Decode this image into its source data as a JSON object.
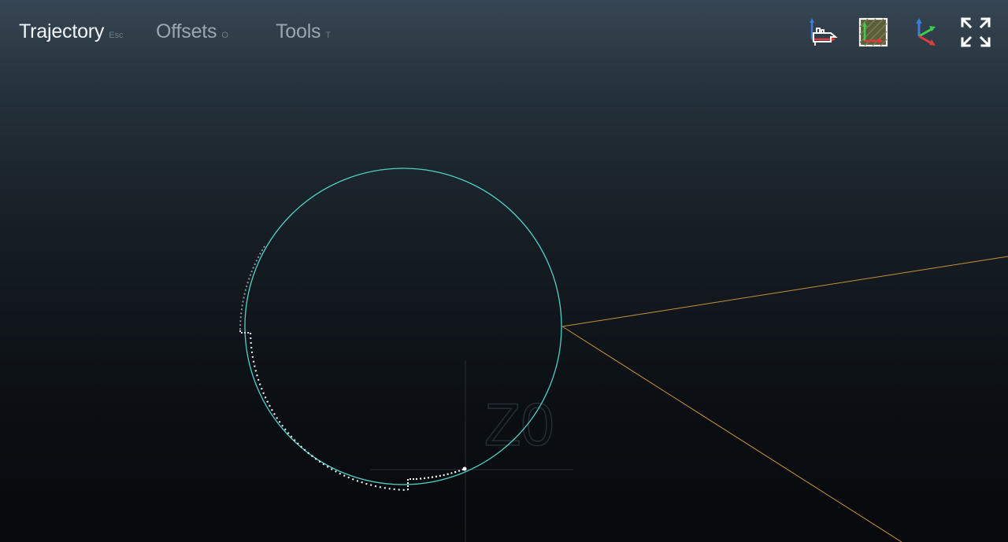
{
  "tabs": [
    {
      "label": "Trajectory",
      "key": "Esc",
      "active": true
    },
    {
      "label": "Offsets",
      "key": "O",
      "active": false
    },
    {
      "label": "Tools",
      "key": "T",
      "active": false
    }
  ],
  "toolbar": {
    "icons": [
      "machine-view-icon",
      "top-plane-view-icon",
      "axes-view-icon",
      "fullscreen-icon"
    ]
  },
  "scene": {
    "watermark": "Z0",
    "colors": {
      "toolpath": "#4fd1c5",
      "rapid": "#ffffff",
      "view-lines": "#c8913a",
      "grid": "#2a323a"
    }
  }
}
